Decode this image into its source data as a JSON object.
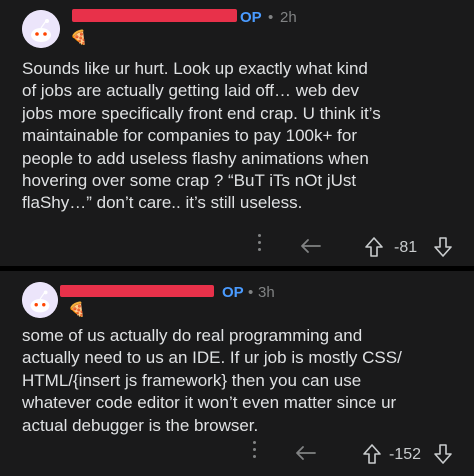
{
  "comments": [
    {
      "username": "redacted",
      "op_badge": "OP",
      "separator": "•",
      "time": "2h",
      "flair_icon": "pizza-slice-icon",
      "body": "Sounds like ur hurt. Look up exactly what kind\nof jobs are actually getting laid off… web dev\njobs more specifically front end crap. U think it’s\nmaintainable for companies to pay 100k+ for\npeople to add useless flashy animations when\nhovering over some crap ? “BuT iTs nOt jUst\nflaShy…” don’t care.. it’s still useless.",
      "score": "-81"
    },
    {
      "username": "redacted",
      "op_badge": "OP",
      "separator": "•",
      "time": "3h",
      "flair_icon": "pizza-slice-icon",
      "body": "some of us actually do real programming and\nactually need to us an IDE. If ur job is mostly CSS/\nHTML/{insert js framework} then you can use\nwhatever code editor it won’t even matter since ur\nactual debugger is the browser.",
      "score": "-152"
    }
  ],
  "colors": {
    "background": "#1a1a1b",
    "op_badge": "#4a9bff",
    "redaction": "#e8314a",
    "text": "#dfe1e3",
    "muted": "#818384"
  }
}
